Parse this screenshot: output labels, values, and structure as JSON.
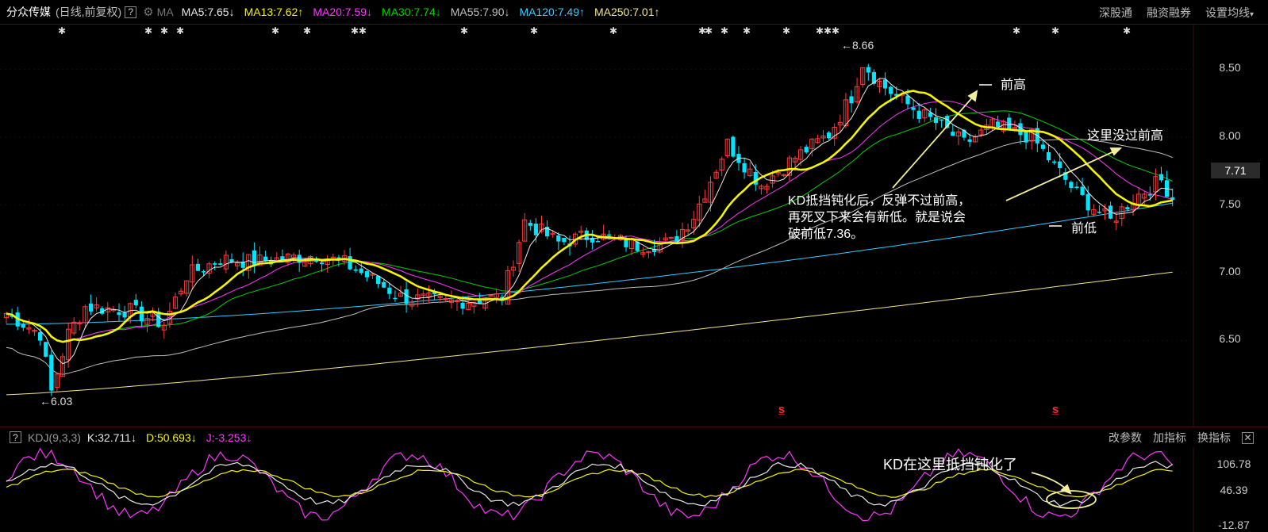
{
  "header": {
    "stock_name": "分众传媒",
    "period": "(日线,前复权)",
    "help": "?",
    "ma_label": "MA",
    "ma_items": [
      {
        "label": "MA5:7.65",
        "arrow": "↓",
        "color": "#e8e8e8"
      },
      {
        "label": "MA13:7.62",
        "arrow": "↑",
        "color": "#f5f500"
      },
      {
        "label": "MA20:7.59",
        "arrow": "↓",
        "color": "#ff33ff"
      },
      {
        "label": "MA30:7.74",
        "arrow": "↓",
        "color": "#00d000"
      },
      {
        "label": "MA55:7.90",
        "arrow": "↓",
        "color": "#bfbfbf"
      },
      {
        "label": "MA120:7.49",
        "arrow": "↑",
        "color": "#33ccff"
      },
      {
        "label": "MA250:7.01",
        "arrow": "↑",
        "color": "#f0e68c"
      }
    ],
    "links": [
      "深股通",
      "融资融券",
      "设置均线"
    ]
  },
  "price_axis": {
    "labels": [
      "8.50",
      "8.00",
      "7.50",
      "7.00",
      "6.50"
    ],
    "current": "7.71"
  },
  "annotations": {
    "high_label": "8.66",
    "low_label": "6.03",
    "prev_high": "前高",
    "prev_low": "前低",
    "not_above": "这里没过前高",
    "kd_note_lines": [
      "KD抵挡钝化后，反弹不过前高，",
      "再死叉下来会有新低。就是说会",
      "破前低7.36。"
    ],
    "kdj_note": "KD在这里抵挡钝化了"
  },
  "marks": {
    "s_mark": "s̲"
  },
  "kdj": {
    "help": "?",
    "title": "KDJ(9,3,3)",
    "items": [
      {
        "label": "K:32.711",
        "arrow": "↓",
        "color": "#e8e8e8"
      },
      {
        "label": "D:50.693",
        "arrow": "↓",
        "color": "#f5f500"
      },
      {
        "label": "J:-3.253",
        "arrow": "↓",
        "color": "#ff33ff"
      }
    ],
    "links": [
      "改参数",
      "加指标",
      "换指标"
    ],
    "close": "✕",
    "axis": [
      "106.78",
      "46.39",
      "-12.87"
    ]
  },
  "colors": {
    "up": "#ff3b3b",
    "down": "#00e5ff",
    "ma5": "#e8e8e8",
    "ma13": "#f5f500",
    "ma20": "#ff33ff",
    "ma30": "#00d000",
    "ma55": "#bfbfbf",
    "ma120": "#33ccff",
    "ma250": "#f0e68c"
  }
}
